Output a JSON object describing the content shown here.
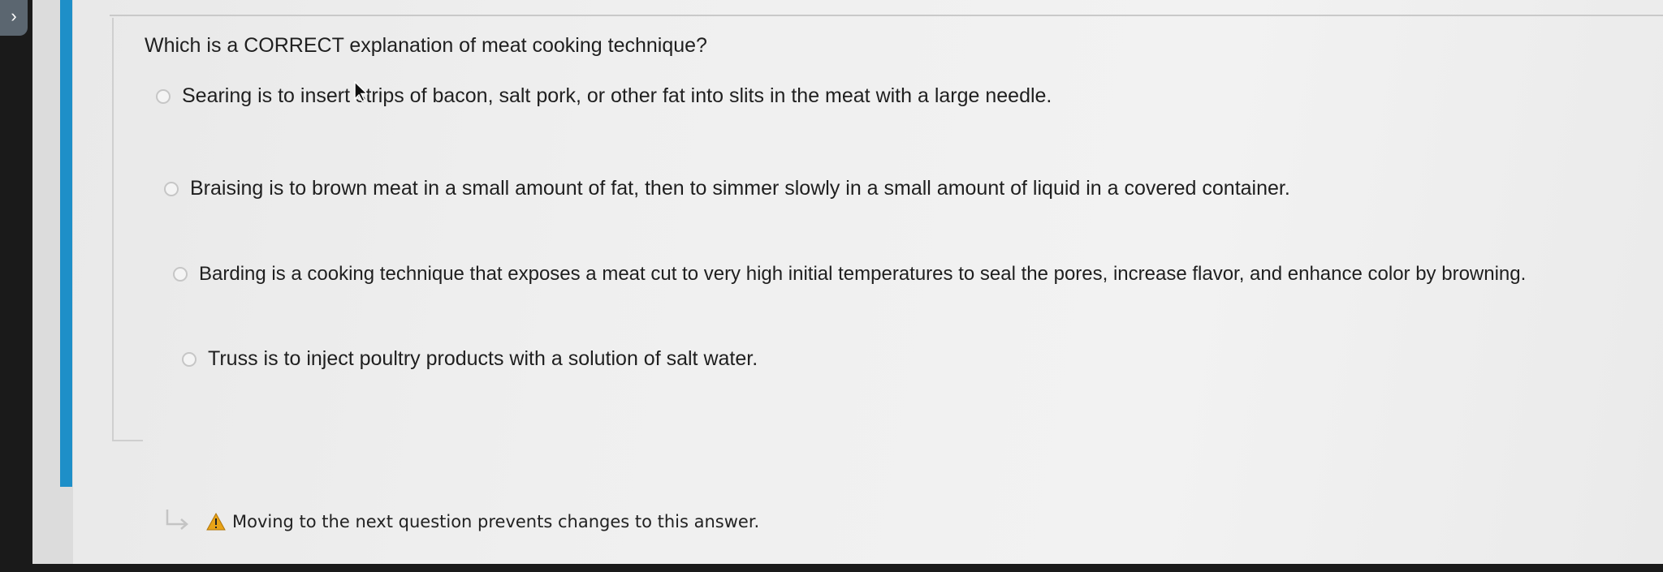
{
  "nav": {
    "collapse_glyph": "›"
  },
  "question": {
    "prompt": "Which is a CORRECT explanation of meat cooking technique?",
    "options": [
      {
        "label": "Searing is to insert strips of bacon, salt pork, or other fat into slits in the meat with a large needle.",
        "selected": false
      },
      {
        "label": "Braising is to brown meat in a small amount of fat, then to simmer slowly in a small amount of liquid in a covered container.",
        "selected": false
      },
      {
        "label": "Barding is a cooking technique that exposes a meat cut to very high initial temperatures to seal the pores, increase flavor, and enhance color by browning.",
        "selected": false
      },
      {
        "label": "Truss is to inject poultry products with a solution of salt water.",
        "selected": false
      }
    ]
  },
  "notice": {
    "text": "Moving to the next question prevents changes to this answer.",
    "icon": "warning-icon",
    "icon_color": "#e8a317"
  },
  "colors": {
    "accent": "#1e8fc8",
    "text": "#1f1f1f"
  }
}
